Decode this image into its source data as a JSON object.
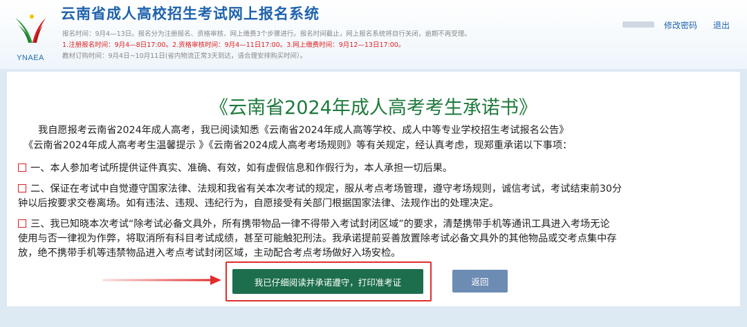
{
  "header": {
    "system_title": "云南省成人高校招生考试网上报名系统",
    "logo_text": "YNAEA",
    "notices": [
      "报名时间：9月4—13日。报名分为注册报名、资格审核、网上缴费3个步骤进行。报名时间截止，网上报名系统将自行关闭，逾期不再受理。",
      "1.注册报名时间：9月4—8日17:00。2.资格审核时间：9月4—11日17:00。3.网上缴费时间：9月12—13日17:00。",
      "教材订购时间：9月4日~10月11日(省内物流正常3天到达，请合理安排购买时间）。"
    ],
    "links": {
      "change_password": "修改密码",
      "logout": "退出"
    }
  },
  "pledge": {
    "title": "《云南省2024年成人高考考生承诺书》",
    "intro_line1": "我自愿报考云南省2024年成人高考，我已阅读知悉《云南省2024年成人高等学校、成人中等专业学校招生考试报名公告》",
    "intro_line2": "《云南省2024年成人高考考生温馨提示 》《云南省2024成人高考考场规则》等有关规定，经认真考虑，现郑重承诺以下事项：",
    "item1_line1": "一、本人参加考试所提供证件真实、准确、有效，如有虚假信息和作假行为，本人承担一切后果。",
    "item2_line1": "二、保证在考试中自觉遵守国家法律、法规和我省有关本次考试的规定，服从考点考场管理，遵守考场规则，诚信考试，考试结束前30分",
    "item2_line2": "钟以后按要求交卷离场。如有违法、违规、违纪行为，自愿接受有关部门根据国家法律、法规作出的处理决定。",
    "item3_line1": "三、我已知晓本次考试“除考试必备文具外，所有携带物品一律不得带入考试封闭区域”的要求，清楚携带手机等通讯工具进入考场无论",
    "item3_line2": "使用与否一律视为作弊，将取消所有科目考试成绩，甚至可能触犯刑法。我承诺提前妥善放置除考试必备文具外的其他物品或交考点集中存",
    "item3_line3": "放，绝不携带手机等违禁物品进入考点考试封闭区域，主动配合考点考场做好入场安检。"
  },
  "actions": {
    "print_label": "我已仔细阅读并承诺遵守，打印准考证",
    "back_label": "返回"
  },
  "colors": {
    "brand_blue": "#1f62ad",
    "title_green": "#1e7a3c",
    "print_button": "#1d6e4c",
    "back_button": "#6d8cb3",
    "annotation_red": "#e12d2d"
  }
}
